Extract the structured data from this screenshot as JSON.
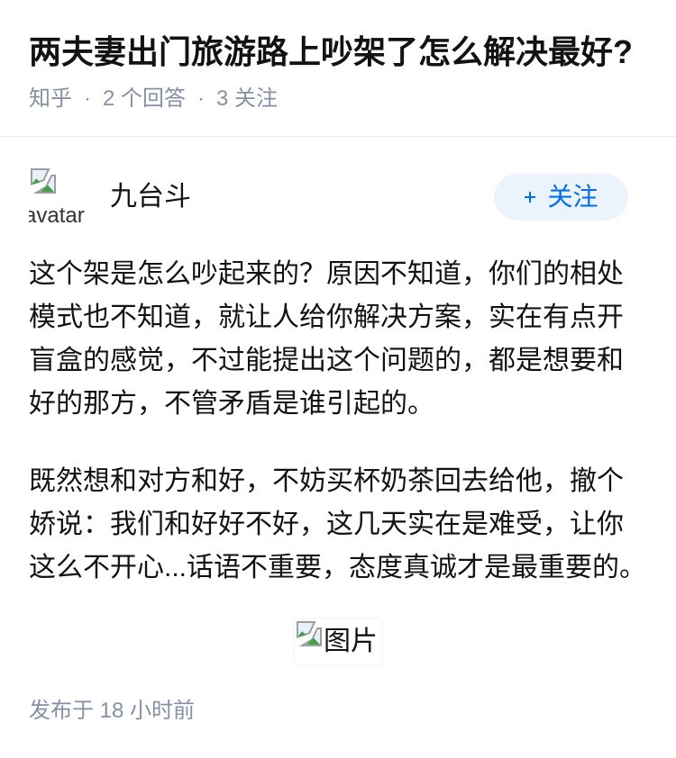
{
  "question": {
    "title": "两夫妻出门旅游路上吵架了怎么解决最好?",
    "meta": {
      "source": "知乎",
      "separator": "·",
      "answers": "2 个回答",
      "followers": "3 关注"
    }
  },
  "answer": {
    "author": {
      "name": "九台斗",
      "avatar_alt": "avatar",
      "avatar_icon": "broken-image-icon"
    },
    "follow_button": {
      "icon": "plus-icon",
      "label": "关注"
    },
    "paragraphs": [
      "这个架是怎么吵起来的？原因不知道，你们的相处模式也不知道，就让人给你解决方案，实在有点开盲盒的感觉，不过能提出这个问题的，都是想要和好的那方，不管矛盾是谁引起的。",
      "既然想和对方和好，不妨买杯奶茶回去给他，撤个娇说：我们和好好不好，这几天实在是难受，让你这么不开心...话语不重要，态度真诚才是最重要的。"
    ],
    "image": {
      "alt": "图片",
      "icon": "broken-image-icon"
    },
    "published": "发布于 18 小时前"
  },
  "colors": {
    "text": "#121212",
    "meta": "#8590a6",
    "accent": "#056de8",
    "follow_bg": "#ebf3fd",
    "divider": "#ebebeb"
  }
}
